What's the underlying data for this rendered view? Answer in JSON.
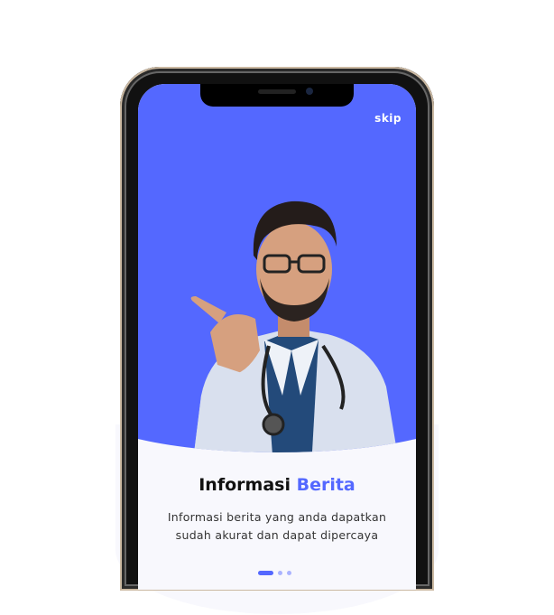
{
  "header": {
    "skip_label": "skip"
  },
  "onboarding": {
    "title_main": "Informasi",
    "title_accent": "Berita",
    "description_line1": "Informasi berita yang anda dapatkan",
    "description_line2": "sudah akurat dan dapat dipercaya",
    "pages_total": 3,
    "current_page": 1
  },
  "colors": {
    "accent": "#5468ff",
    "panel": "#f8f8fd"
  }
}
